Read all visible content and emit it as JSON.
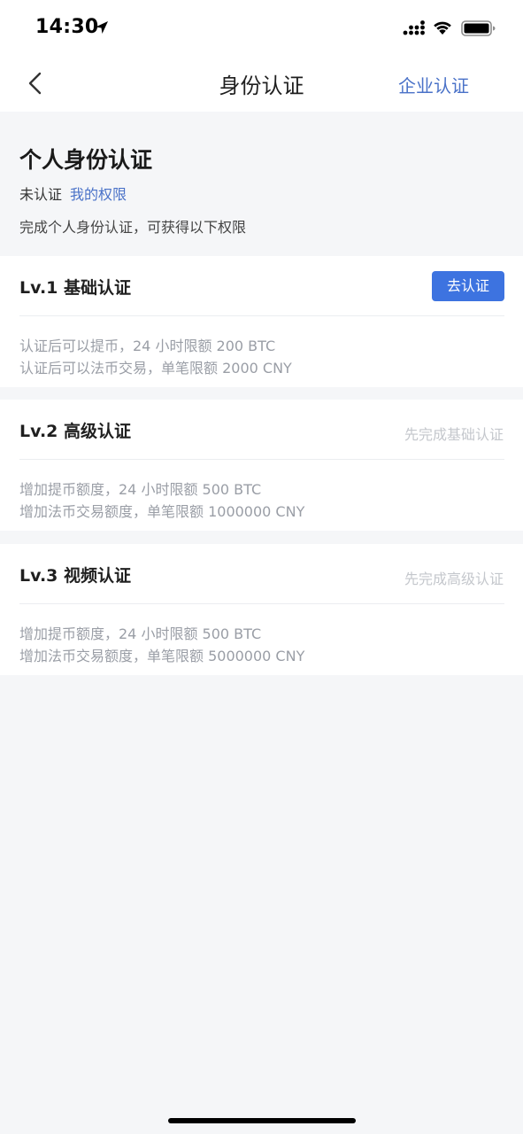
{
  "status_bar": {
    "time": "14:30",
    "icons": [
      "location-arrow-icon",
      "cellular-signal-icon",
      "wifi-icon",
      "battery-icon"
    ]
  },
  "nav": {
    "back_icon": "chevron-left-icon",
    "title": "身份认证",
    "enterprise_link": "企业认证"
  },
  "header": {
    "title": "个人身份认证",
    "status": "未认证",
    "permissions_link": "我的权限",
    "description": "完成个人身份认证，可获得以下权限"
  },
  "levels": [
    {
      "title": "Lv.1 基础认证",
      "action_label": "去认证",
      "benefits": [
        "认证后可以提币，24 小时限额 200 BTC",
        "认证后可以法币交易，单笔限额 2000 CNY"
      ]
    },
    {
      "title": "Lv.2 高级认证",
      "prerequisite": "先完成基础认证",
      "benefits": [
        "增加提币额度，24 小时限额 500 BTC",
        "增加法币交易额度，单笔限额 1000000 CNY"
      ]
    },
    {
      "title": "Lv.3 视频认证",
      "prerequisite": "先完成高级认证",
      "benefits": [
        "增加提币额度，24 小时限额 500 BTC",
        "增加法币交易额度，单笔限额 5000000 CNY"
      ]
    }
  ],
  "colors": {
    "accent": "#3d73e0",
    "link": "#4a72c8",
    "background": "#f5f6f8",
    "muted_text": "#9a9ea6",
    "disabled_text": "#c4c7cc"
  }
}
